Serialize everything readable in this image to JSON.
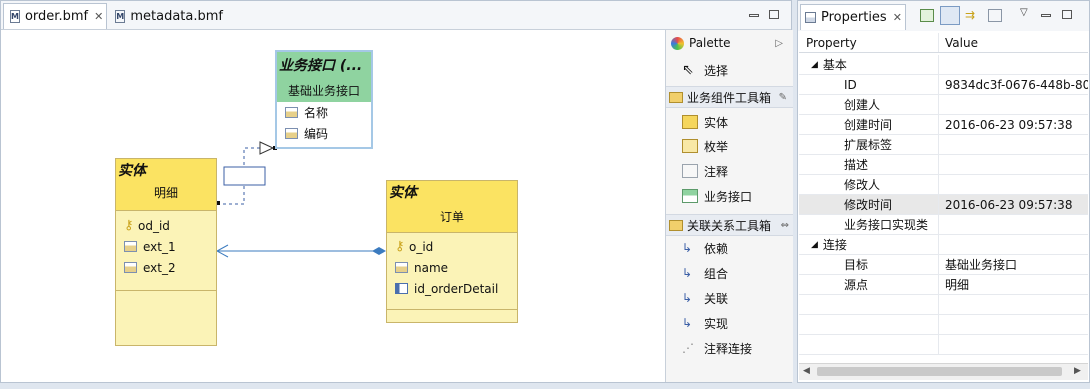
{
  "editor": {
    "tabs": [
      {
        "icon": "M",
        "label": "order.bmf",
        "active": true
      },
      {
        "icon": "M",
        "label": "metadata.bmf",
        "active": false
      }
    ]
  },
  "diagram": {
    "interface_box": {
      "stereotype": "业务接口 (...",
      "name": "基础业务接口",
      "attrs": [
        "名称",
        "编码"
      ]
    },
    "entity_detail": {
      "stereotype": "实体",
      "name": "明细",
      "attrs": [
        "od_id",
        "ext_1",
        "ext_2"
      ]
    },
    "entity_order": {
      "stereotype": "实体",
      "name": "订单",
      "attrs": [
        "o_id",
        "name",
        "id_orderDetail"
      ]
    }
  },
  "palette": {
    "title": "Palette",
    "select": "选择",
    "sections": [
      {
        "label": "业务组件工具箱",
        "items": [
          "实体",
          "枚举",
          "注释",
          "业务接口"
        ]
      },
      {
        "label": "关联关系工具箱",
        "items": [
          "依赖",
          "组合",
          "关联",
          "实现",
          "注释连接"
        ]
      }
    ]
  },
  "properties": {
    "title": "Properties",
    "col_property": "Property",
    "col_value": "Value",
    "group1": "基本",
    "rows1": [
      {
        "p": "ID",
        "v": "9834dc3f-0676-448b-80"
      },
      {
        "p": "创建人",
        "v": ""
      },
      {
        "p": "创建时间",
        "v": "2016-06-23 09:57:38"
      },
      {
        "p": "扩展标签",
        "v": ""
      },
      {
        "p": "描述",
        "v": ""
      },
      {
        "p": "修改人",
        "v": ""
      },
      {
        "p": "修改时间",
        "v": "2016-06-23 09:57:38"
      },
      {
        "p": "业务接口实现类",
        "v": ""
      }
    ],
    "group2": "连接",
    "rows2": [
      {
        "p": "目标",
        "v": "基础业务接口"
      },
      {
        "p": "源点",
        "v": "明细"
      }
    ]
  }
}
